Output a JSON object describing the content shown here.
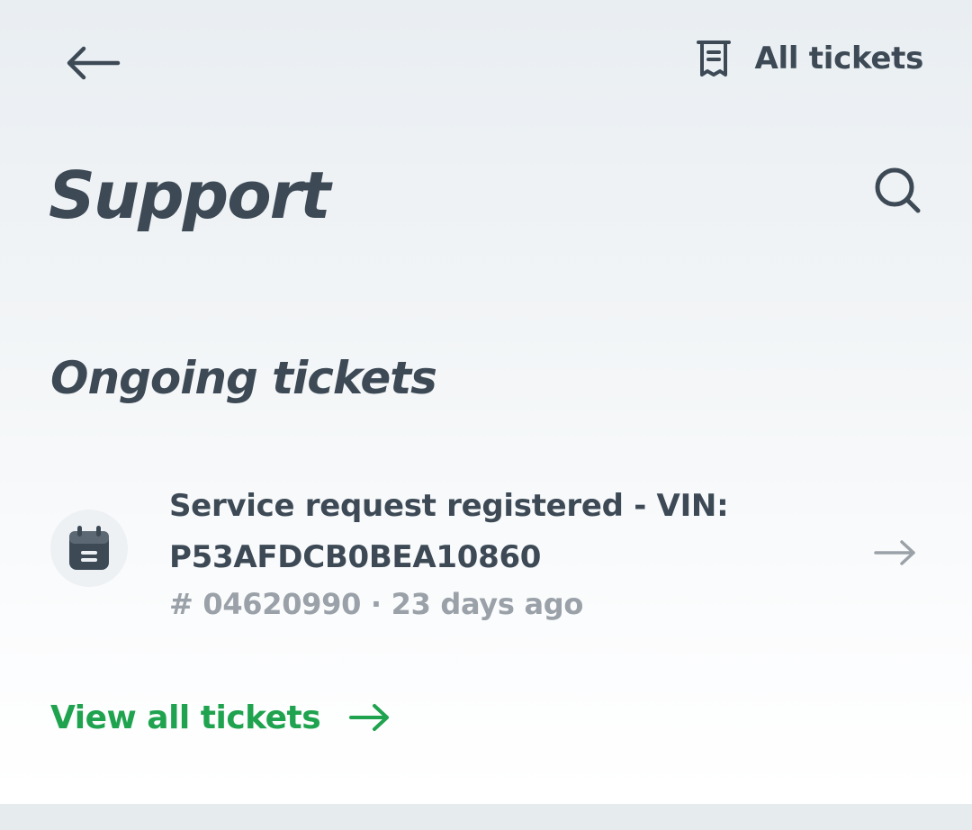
{
  "header": {
    "back_icon": "arrow-left-icon",
    "all_tickets_icon": "receipt-icon",
    "all_tickets_label": "All tickets"
  },
  "page": {
    "title": "Support",
    "search_icon": "search-icon"
  },
  "ongoing": {
    "section_title": "Ongoing tickets",
    "tickets": [
      {
        "icon": "calendar-icon",
        "title": "Service request registered - VIN: P53AFDCB0BEA10860",
        "meta": "# 04620990 · 23 days ago",
        "arrow_icon": "arrow-right-icon"
      }
    ]
  },
  "footer": {
    "view_all_label": "View all tickets",
    "view_all_icon": "arrow-right-icon"
  },
  "colors": {
    "text_primary": "#3d4a56",
    "text_secondary": "#9aa1a8",
    "accent_green": "#1fa34f",
    "background_top": "#e9eef2",
    "background_bottom": "#ffffff"
  }
}
